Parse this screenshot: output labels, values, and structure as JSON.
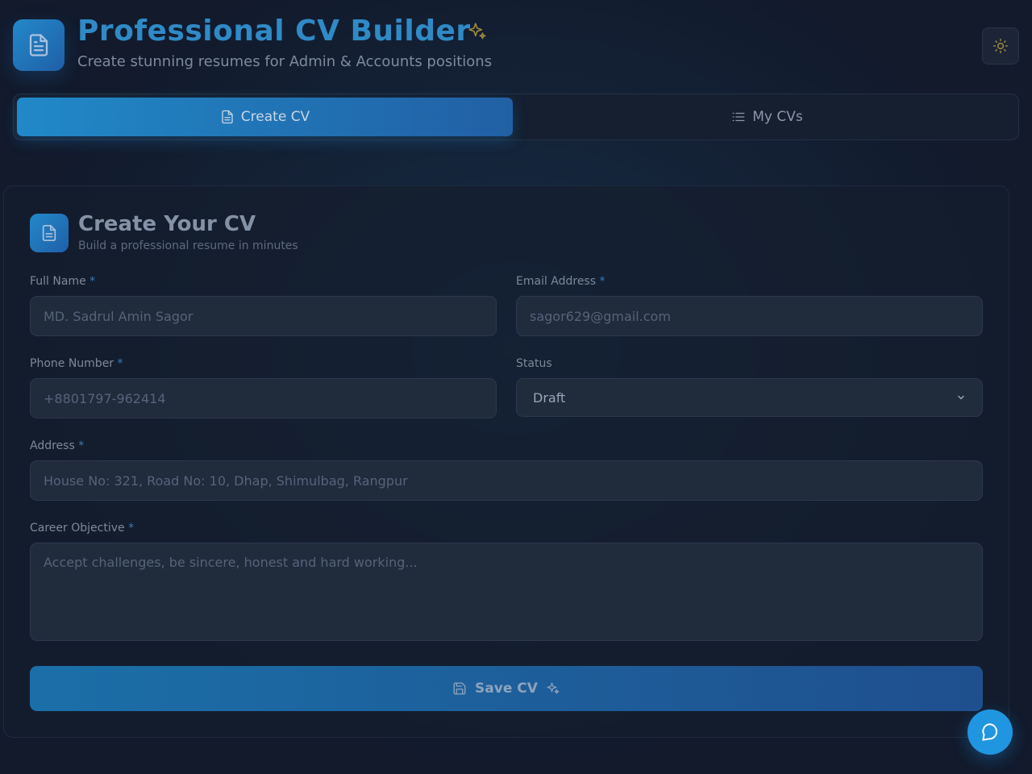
{
  "header": {
    "title": "Professional CV Builder",
    "subtitle": "Create stunning resumes for Admin & Accounts positions",
    "logo_icon": "document-icon",
    "sparkle_icon": "sparkles-icon",
    "theme_icon": "sun-icon"
  },
  "tabs": [
    {
      "label": "Create CV",
      "icon": "document-icon",
      "active": true
    },
    {
      "label": "My CVs",
      "icon": "list-icon",
      "active": false
    }
  ],
  "form": {
    "title": "Create Your CV",
    "subtitle": "Build a professional resume in minutes",
    "required_mark": "*",
    "full_name": {
      "label": "Full Name",
      "placeholder": "MD. Sadrul Amin Sagor"
    },
    "email": {
      "label": "Email Address",
      "placeholder": "sagor629@gmail.com"
    },
    "phone": {
      "label": "Phone Number",
      "placeholder": "+8801797-962414"
    },
    "status": {
      "label": "Status",
      "value": "Draft"
    },
    "address": {
      "label": "Address",
      "placeholder": "House No: 321, Road No: 10, Dhap, Shimulbag, Rangpur"
    },
    "objective": {
      "label": "Career Objective",
      "placeholder": "Accept challenges, be sincere, honest and hard working..."
    },
    "save_label": "Save CV"
  },
  "colors": {
    "accent": "#2189c8",
    "background": "#121a2c",
    "chat_button": "#2196e0"
  }
}
